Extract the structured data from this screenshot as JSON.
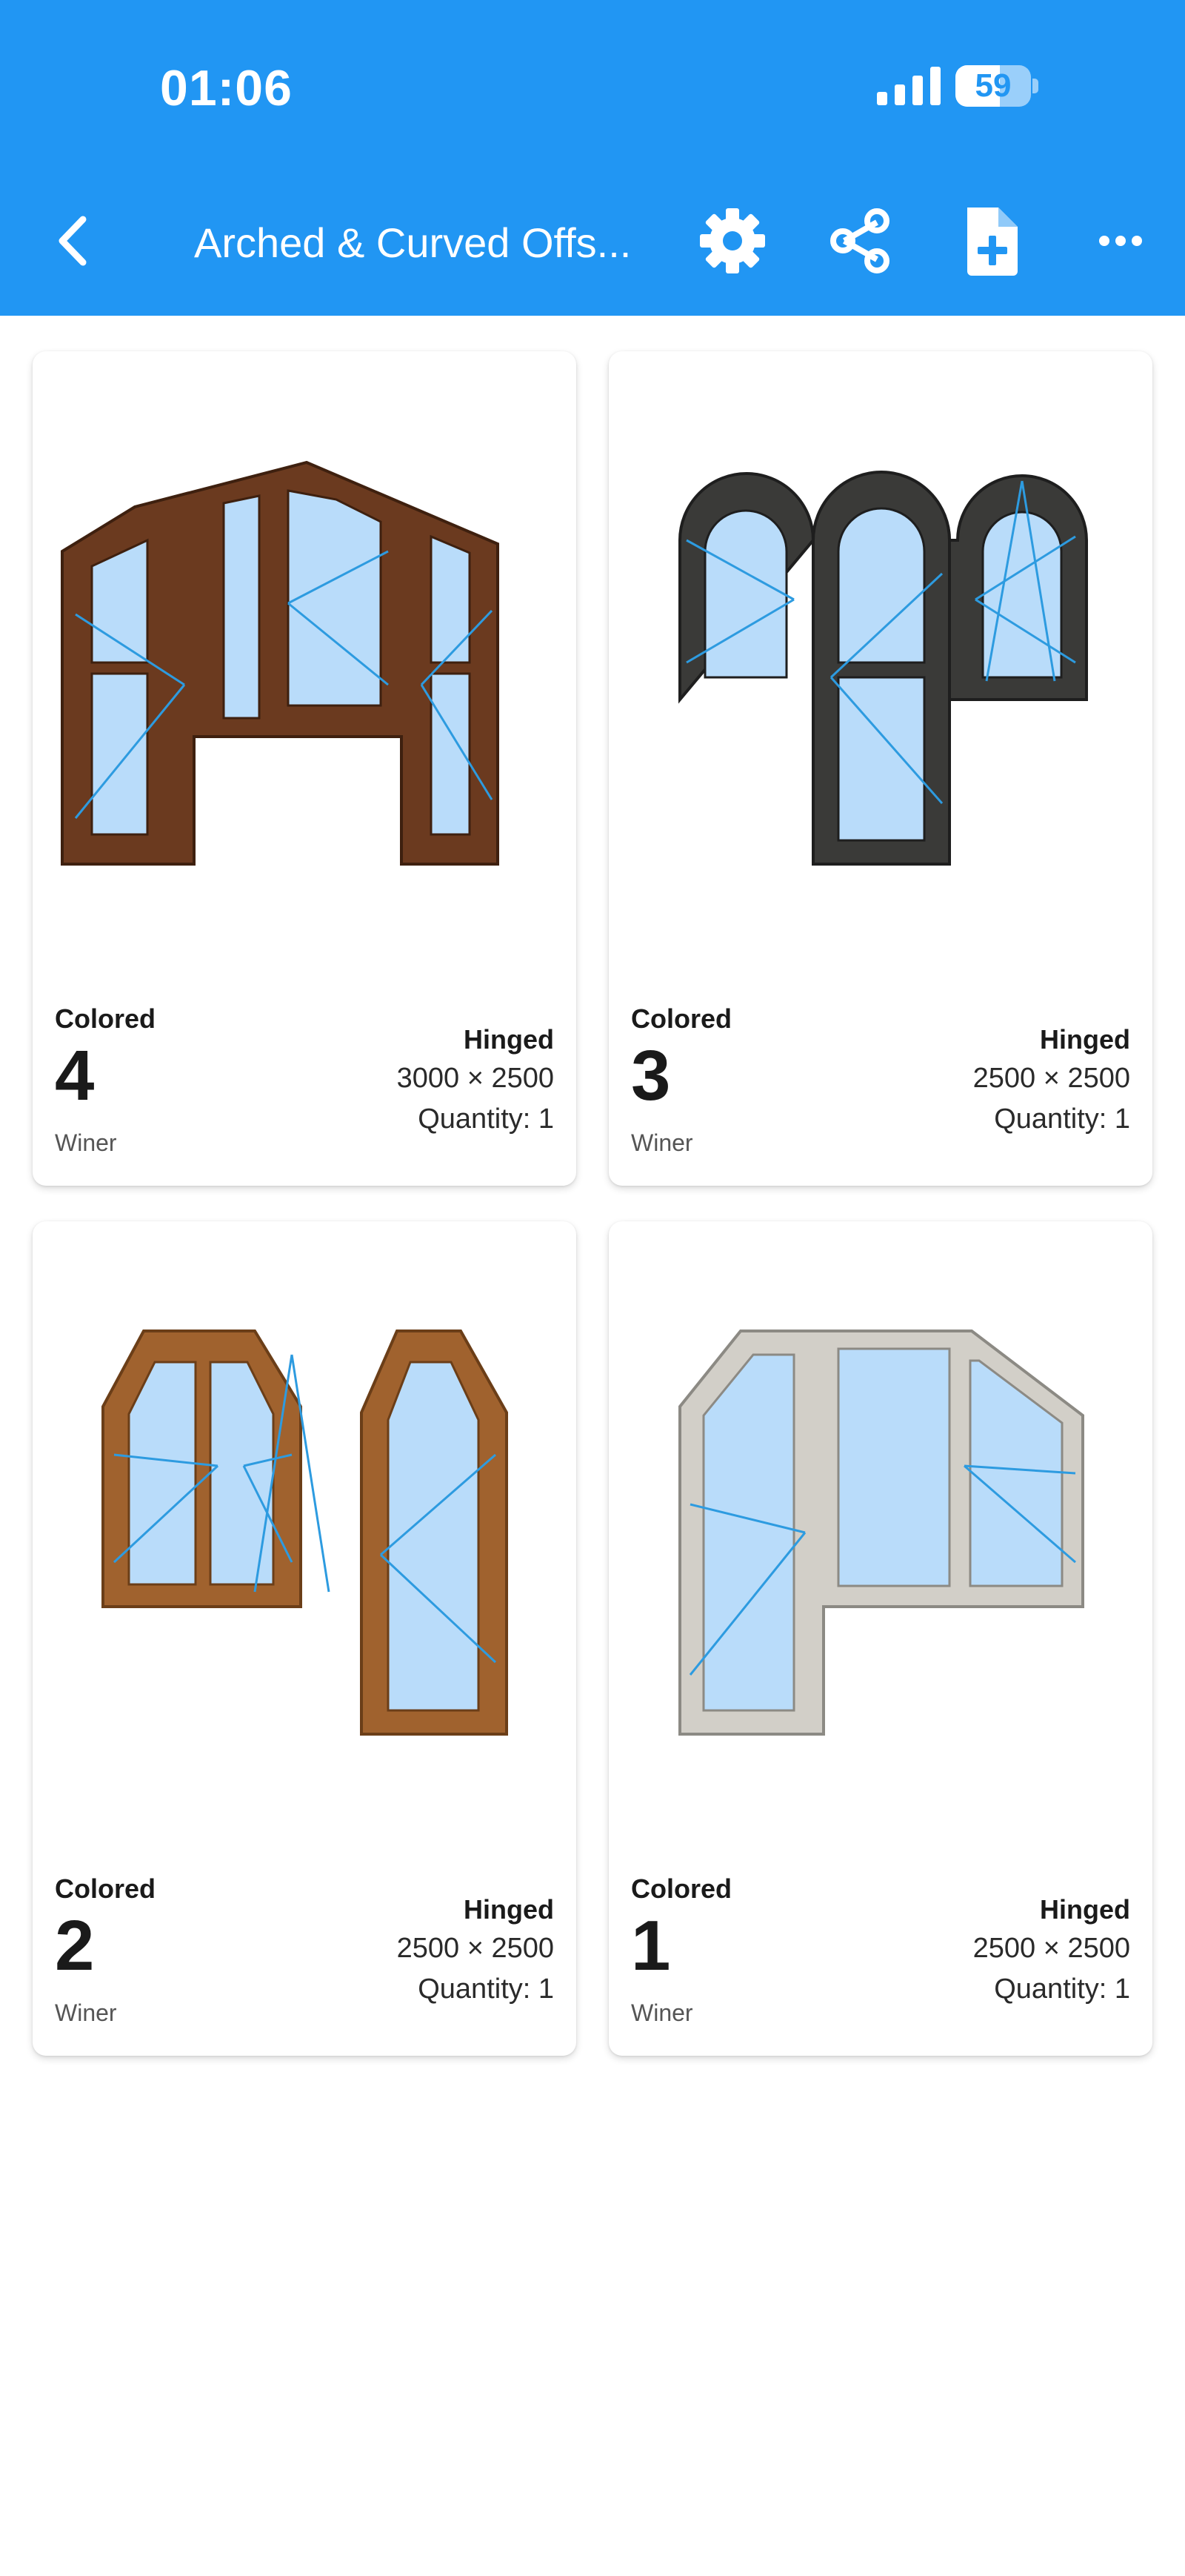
{
  "status": {
    "time": "01:06",
    "battery": "59",
    "battery_level": 0.59
  },
  "header": {
    "title": "Arched & Curved Offs...",
    "back_icon": "chevron-left-icon",
    "actions": [
      "gear-icon",
      "share-icon",
      "add-document-icon",
      "more-horizontal-icon"
    ]
  },
  "colors": {
    "primary": "#2196F3",
    "glass": "#b9dcfa",
    "sash_line": "#2d9be0"
  },
  "cards": [
    {
      "color": "Colored",
      "number": "4",
      "brand": "Winer",
      "type": "Hinged",
      "dimensions": "3000 × 2500",
      "quantity": "Quantity: 1",
      "frame_color": "#6b3a1f"
    },
    {
      "color": "Colored",
      "number": "3",
      "brand": "Winer",
      "type": "Hinged",
      "dimensions": "2500 × 2500",
      "quantity": "Quantity: 1",
      "frame_color": "#3a3a38"
    },
    {
      "color": "Colored",
      "number": "2",
      "brand": "Winer",
      "type": "Hinged",
      "dimensions": "2500 × 2500",
      "quantity": "Quantity: 1",
      "frame_color": "#a0622e"
    },
    {
      "color": "Colored",
      "number": "1",
      "brand": "Winer",
      "type": "Hinged",
      "dimensions": "2500 × 2500",
      "quantity": "Quantity: 1",
      "frame_color": "#d2cfc8"
    }
  ]
}
